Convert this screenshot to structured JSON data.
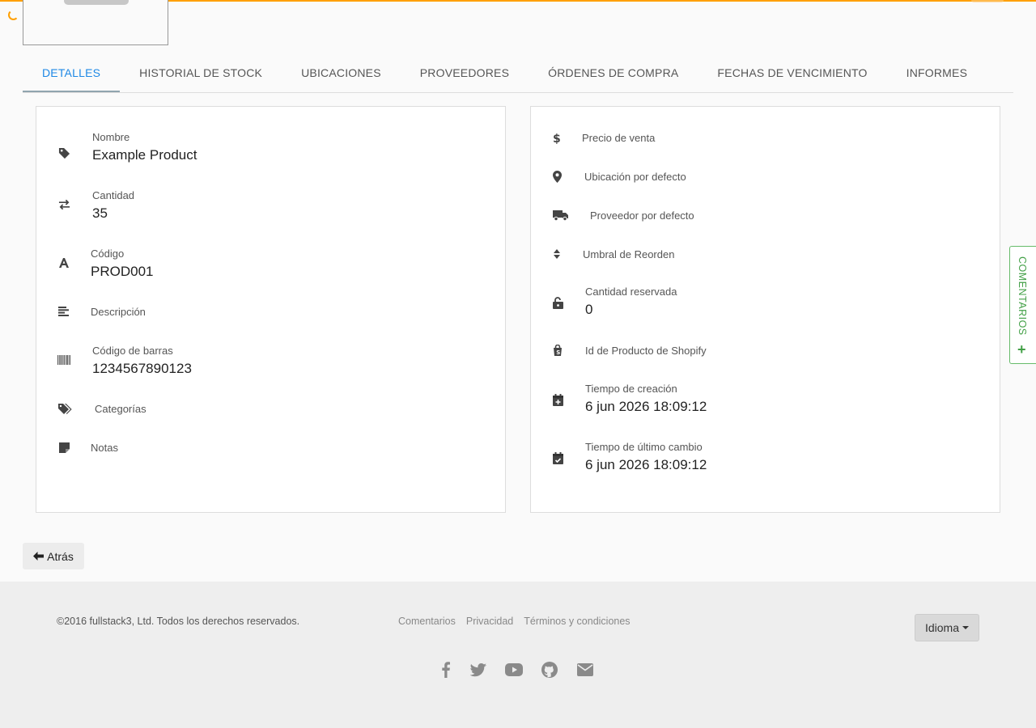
{
  "colors": {
    "accent": "#ffa000",
    "active_tab": "#1e88e5",
    "comments": "#43a047"
  },
  "tabs": [
    {
      "label": "DETALLES",
      "active": true
    },
    {
      "label": "HISTORIAL DE STOCK"
    },
    {
      "label": "UBICACIONES"
    },
    {
      "label": "PROVEEDORES"
    },
    {
      "label": "ÓRDENES DE COMPRA"
    },
    {
      "label": "FECHAS DE VENCIMIENTO"
    },
    {
      "label": "INFORMES"
    }
  ],
  "left_fields": {
    "name": {
      "icon": "tag-icon",
      "label": "Nombre",
      "value": "Example Product"
    },
    "quantity": {
      "icon": "exchange-icon",
      "label": "Cantidad",
      "value": "35"
    },
    "code": {
      "icon": "font-icon",
      "label": "Código",
      "value": "PROD001"
    },
    "description": {
      "icon": "align-left-icon",
      "label": "Descripción"
    },
    "barcode": {
      "icon": "barcode-icon",
      "label": "Código de barras",
      "value": "1234567890123"
    },
    "categories": {
      "icon": "tags-icon",
      "label": "Categorías"
    },
    "notes": {
      "icon": "sticky-note-icon",
      "label": "Notas"
    }
  },
  "right_fields": {
    "price": {
      "icon": "dollar-icon",
      "label": "Precio de venta"
    },
    "location": {
      "icon": "map-marker-icon",
      "label": "Ubicación por defecto"
    },
    "supplier": {
      "icon": "truck-icon",
      "label": "Proveedor por defecto"
    },
    "reorder": {
      "icon": "sort-icon",
      "label": "Umbral de Reorden"
    },
    "reserved": {
      "icon": "unlock-icon",
      "label": "Cantidad reservada",
      "value": "0"
    },
    "shopify": {
      "icon": "shopify-icon",
      "label": "Id de Producto de Shopify"
    },
    "created": {
      "icon": "calendar-plus-icon",
      "label": "Tiempo de creación",
      "value": "6 jun 2026 18:09:12"
    },
    "modified": {
      "icon": "calendar-check-icon",
      "label": "Tiempo de último cambio",
      "value": "6 jun 2026 18:09:12"
    }
  },
  "comments_tab": {
    "label": "COMENTARIOS"
  },
  "back_button": {
    "label": "Atrás"
  },
  "footer": {
    "copyright": "©2016 fullstack3, Ltd. Todos los derechos reservados.",
    "links": [
      "Comentarios",
      "Privacidad",
      "Términos y condiciones"
    ],
    "language_button": "Idioma",
    "socials": [
      "facebook-icon",
      "twitter-icon",
      "youtube-icon",
      "github-icon",
      "envelope-icon"
    ]
  }
}
